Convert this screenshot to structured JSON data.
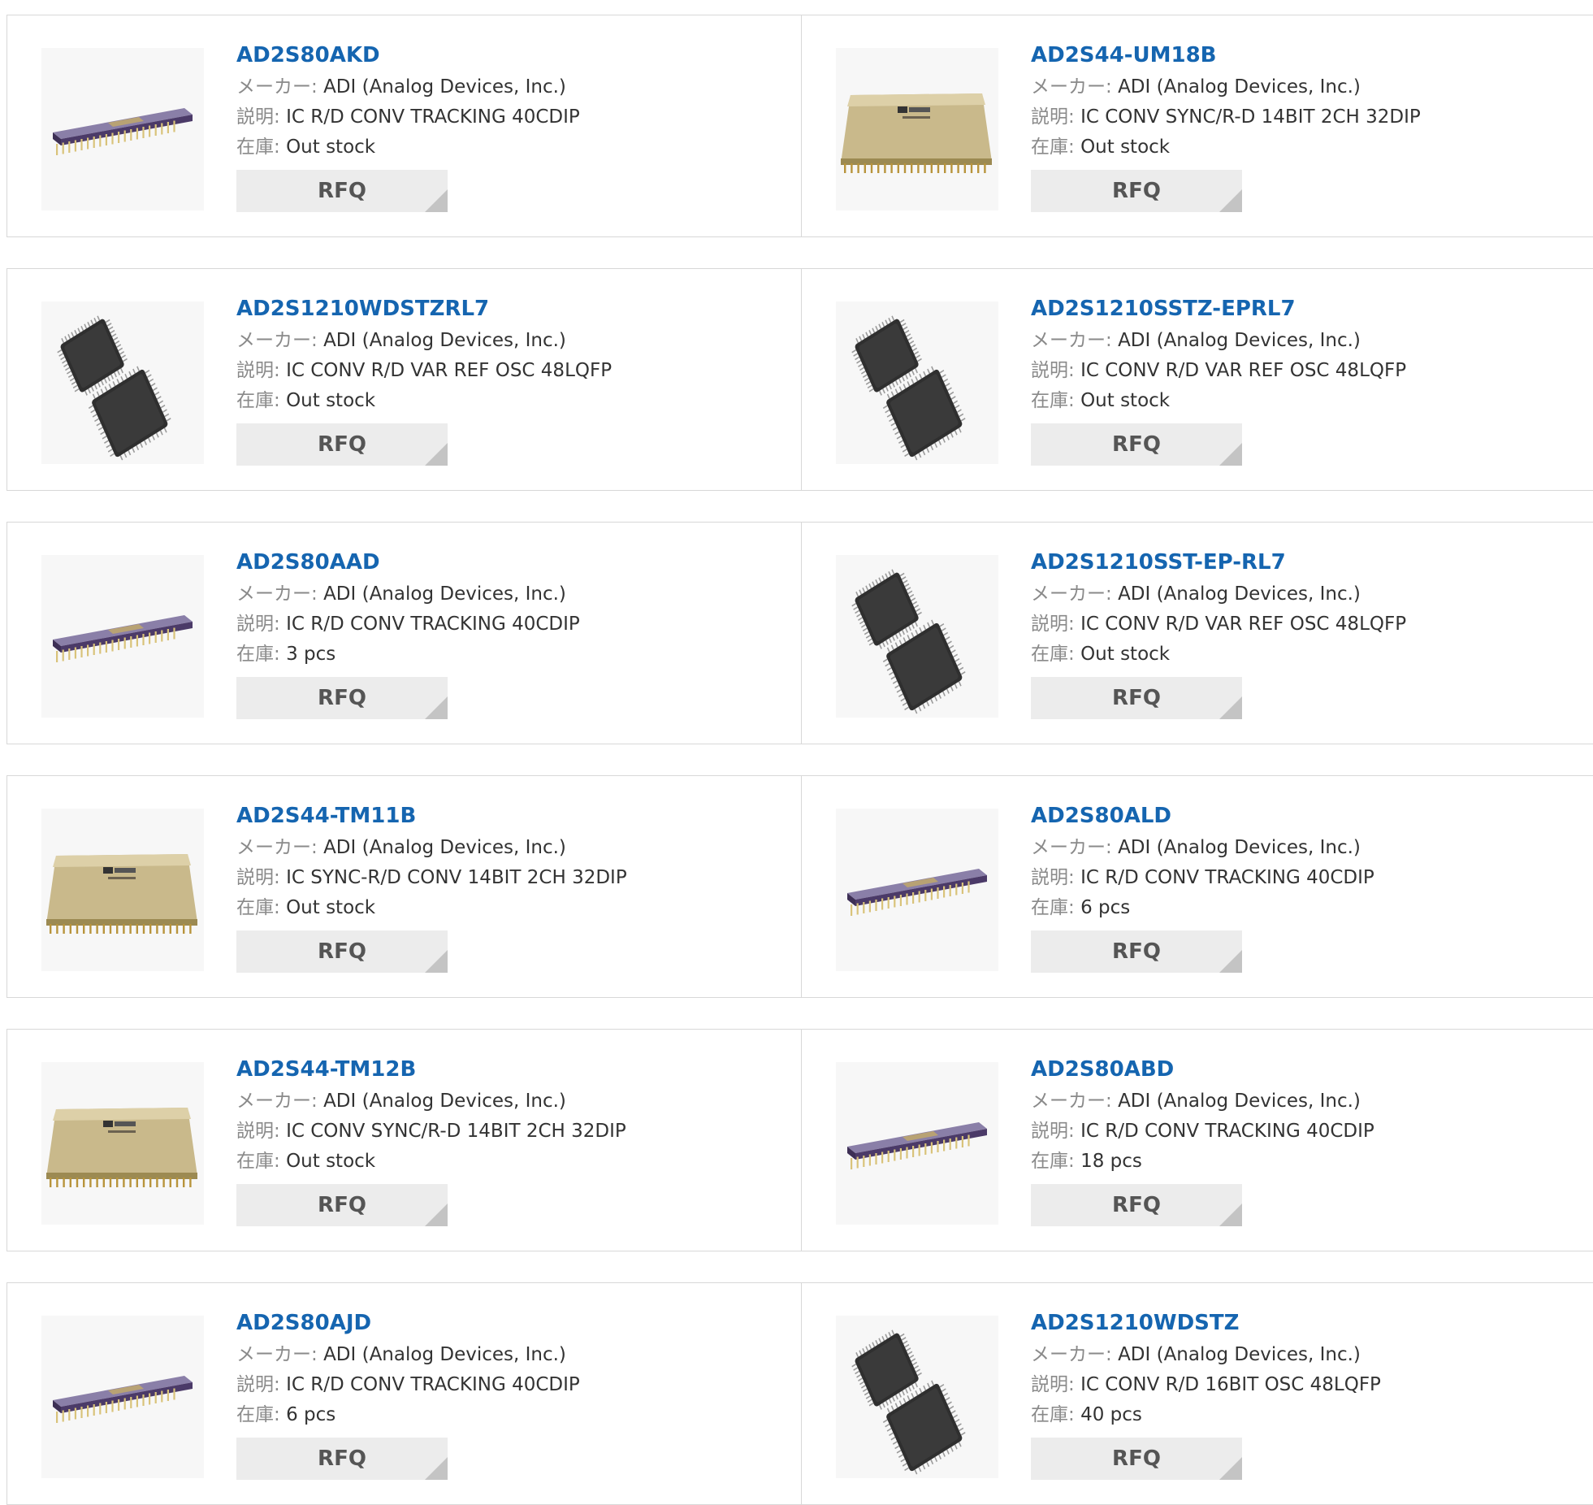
{
  "labels": {
    "maker": "メーカー:",
    "description": "説明:",
    "stock": "在庫:",
    "rfq": "RFQ"
  },
  "products": [
    {
      "part": "AD2S80AKD",
      "maker": "ADI (Analog Devices, Inc.)",
      "description": "IC R/D CONV TRACKING 40CDIP",
      "stock": "Out stock",
      "image": "cdip-40-chip-icon"
    },
    {
      "part": "AD2S44-UM18B",
      "maker": "ADI (Analog Devices, Inc.)",
      "description": "IC CONV SYNC/R-D 14BIT 2CH 32DIP",
      "stock": "Out stock",
      "image": "dip-32-module-icon"
    },
    {
      "part": "AD2S1210WDSTZRL7",
      "maker": "ADI (Analog Devices, Inc.)",
      "description": "IC CONV R/D VAR REF OSC 48LQFP",
      "stock": "Out stock",
      "image": "lqfp-48-chip-icon"
    },
    {
      "part": "AD2S1210SSTZ-EPRL7",
      "maker": "ADI (Analog Devices, Inc.)",
      "description": "IC CONV R/D VAR REF OSC 48LQFP",
      "stock": "Out stock",
      "image": "lqfp-48-chip-icon"
    },
    {
      "part": "AD2S80AAD",
      "maker": "ADI (Analog Devices, Inc.)",
      "description": "IC R/D CONV TRACKING 40CDIP",
      "stock": "3 pcs",
      "image": "cdip-40-chip-icon"
    },
    {
      "part": "AD2S1210SST-EP-RL7",
      "maker": "ADI (Analog Devices, Inc.)",
      "description": "IC CONV R/D VAR REF OSC 48LQFP",
      "stock": "Out stock",
      "image": "lqfp-48-chip-icon"
    },
    {
      "part": "AD2S44-TM11B",
      "maker": "ADI (Analog Devices, Inc.)",
      "description": "IC SYNC-R/D CONV 14BIT 2CH 32DIP",
      "stock": "Out stock",
      "image": "dip-32-module-icon"
    },
    {
      "part": "AD2S80ALD",
      "maker": "ADI (Analog Devices, Inc.)",
      "description": "IC R/D CONV TRACKING 40CDIP",
      "stock": "6 pcs",
      "image": "cdip-40-chip-icon"
    },
    {
      "part": "AD2S44-TM12B",
      "maker": "ADI (Analog Devices, Inc.)",
      "description": "IC CONV SYNC/R-D 14BIT 2CH 32DIP",
      "stock": "Out stock",
      "image": "dip-32-module-icon"
    },
    {
      "part": "AD2S80ABD",
      "maker": "ADI (Analog Devices, Inc.)",
      "description": "IC R/D CONV TRACKING 40CDIP",
      "stock": "18 pcs",
      "image": "cdip-40-chip-icon"
    },
    {
      "part": "AD2S80AJD",
      "maker": "ADI (Analog Devices, Inc.)",
      "description": "IC R/D CONV TRACKING 40CDIP",
      "stock": "6 pcs",
      "image": "cdip-40-chip-icon"
    },
    {
      "part": "AD2S1210WDSTZ",
      "maker": "ADI (Analog Devices, Inc.)",
      "description": "IC CONV R/D 16BIT OSC 48LQFP",
      "stock": "40 pcs",
      "image": "lqfp-48-chip-icon"
    }
  ],
  "colors": {
    "link": "#1565b0",
    "label": "#8a8a8a",
    "border": "#d8d8d8",
    "button_bg": "#ececec",
    "button_corner": "#c4c4c4"
  }
}
